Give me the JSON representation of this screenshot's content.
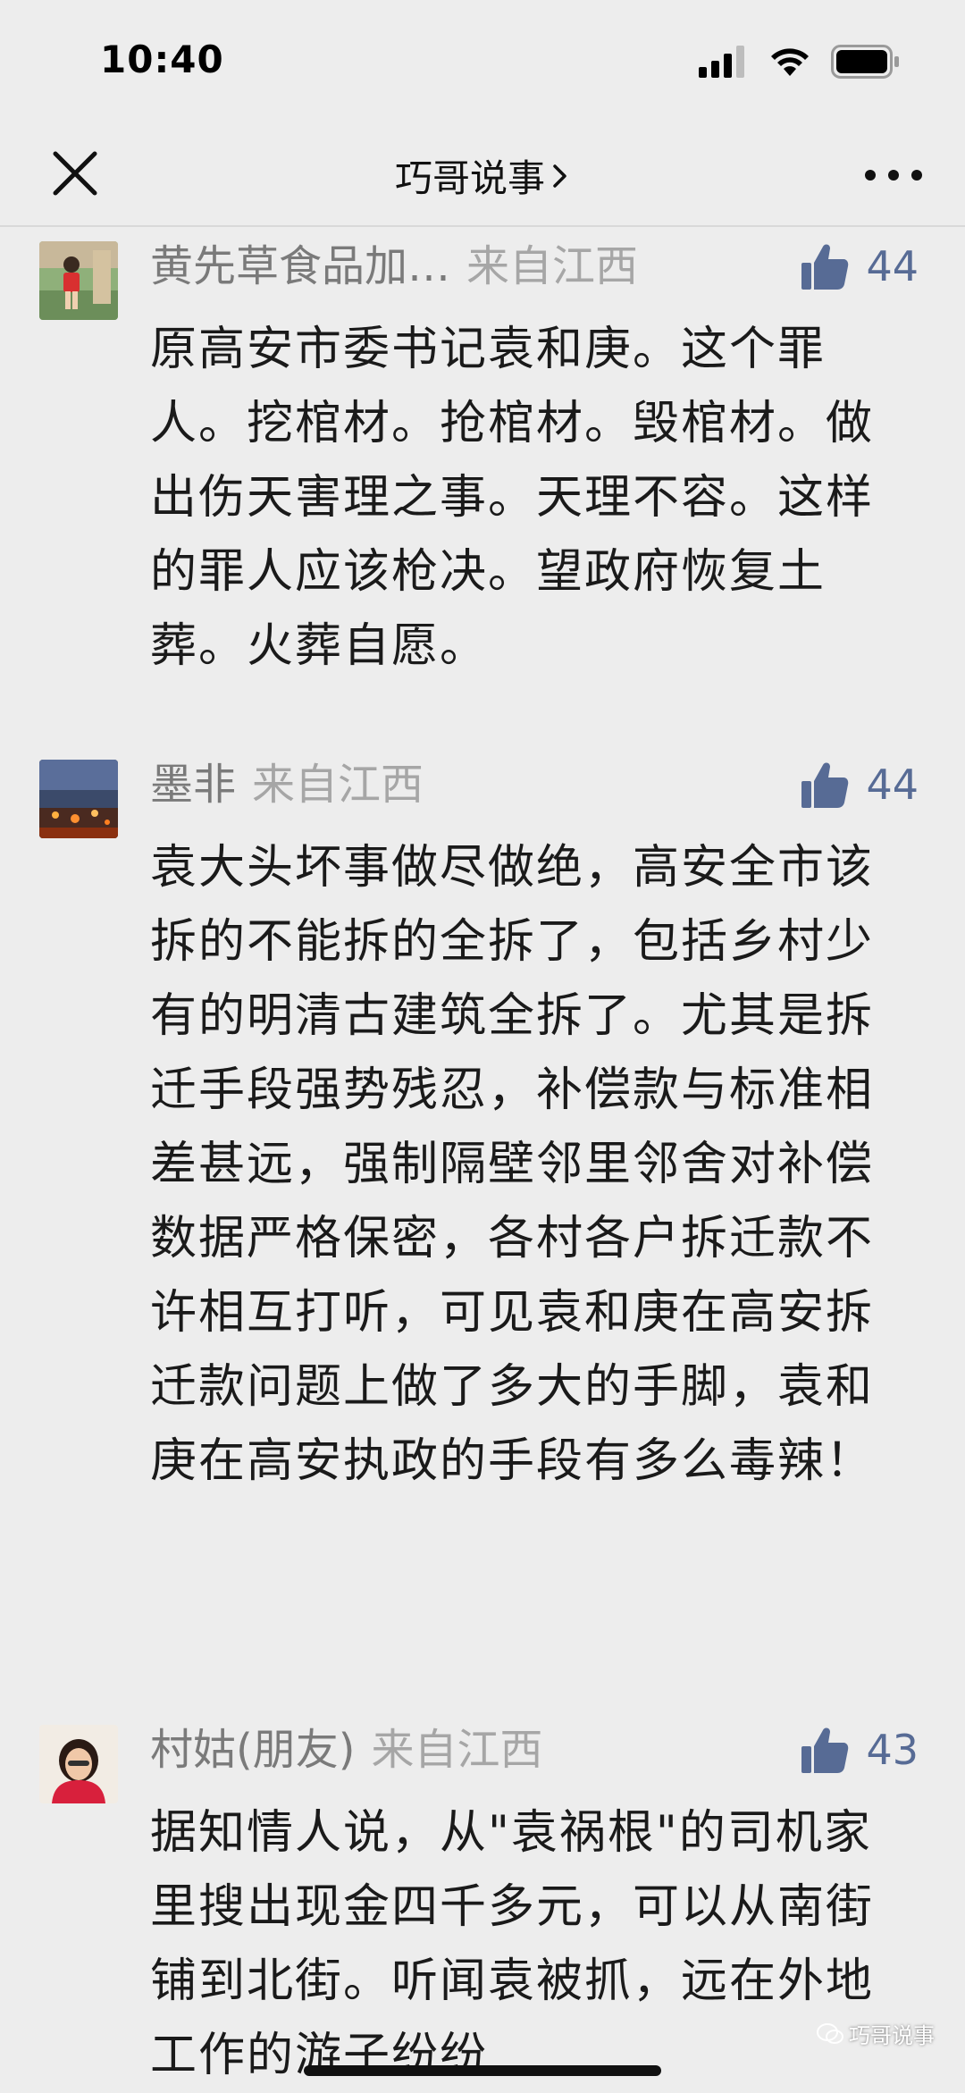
{
  "status_bar": {
    "time": "10:40"
  },
  "nav": {
    "title": "巧哥说事",
    "title_chevron": "›",
    "close_icon": "close-icon",
    "more_icon": "more-icon"
  },
  "comments": [
    {
      "name": "黄先草食品加…",
      "location": "来自江西",
      "likes": "44",
      "text": "原高安市委书记袁和庚。这个罪人。挖棺材。抢棺材。毁棺材。做出伤天害理之事。天理不容。这样的罪人应该枪决。望政府恢复土葬。火葬自愿。"
    },
    {
      "name": "墨非",
      "location": "来自江西",
      "likes": "44",
      "text": "袁大头坏事做尽做绝，高安全市该拆的不能拆的全拆了，包括乡村少有的明清古建筑全拆了。尤其是拆迁手段强势残忍，补偿款与标准相差甚远，强制隔壁邻里邻舍对补偿数据严格保密，各村各户拆迁款不许相互打听，可见袁和庚在高安拆迁款问题上做了多大的手脚，袁和庚在高安执政的手段有多么毒辣！"
    },
    {
      "name": "村姑(朋友)",
      "location": "来自江西",
      "likes": "43",
      "text": "据知情人说，从\"袁祸根\"的司机家里搜出现金四千多元，可以从南街铺到北街。听闻袁被抓，远在外地工作的游子纷纷"
    }
  ],
  "watermark": {
    "text": "巧哥说事"
  },
  "colors": {
    "background": "#ededed",
    "like_blue": "#576b95",
    "name_gray": "#7a7a7a",
    "location_gray": "#a6a6a6"
  }
}
